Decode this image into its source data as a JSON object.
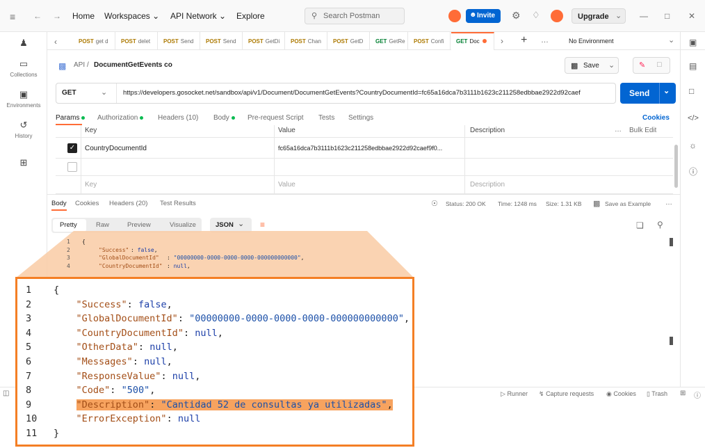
{
  "topbar": {
    "home": "Home",
    "workspaces": "Workspaces",
    "api_network": "API Network",
    "explore": "Explore",
    "search_placeholder": "Search Postman",
    "invite": "Invite",
    "upgrade": "Upgrade"
  },
  "sidebar": {
    "items": [
      {
        "label": "Collections"
      },
      {
        "label": "Environments"
      },
      {
        "label": "History"
      }
    ]
  },
  "tabs": [
    {
      "method": "POST",
      "label": "get d"
    },
    {
      "method": "POST",
      "label": "delet"
    },
    {
      "method": "POST",
      "label": "Send"
    },
    {
      "method": "POST",
      "label": "Send"
    },
    {
      "method": "POST",
      "label": "GetDi"
    },
    {
      "method": "POST",
      "label": "Chan"
    },
    {
      "method": "POST",
      "label": "GetD"
    },
    {
      "method": "GET",
      "label": "GetRe"
    },
    {
      "method": "POST",
      "label": "Confi"
    },
    {
      "method": "GET",
      "label": "Doc"
    }
  ],
  "environment": "No Environment",
  "breadcrumb": {
    "root": "API",
    "sep": "/",
    "name": "DocumentGetEvents co"
  },
  "save_label": "Save",
  "request": {
    "method": "GET",
    "url": "https://developers.gosocket.net/sandbox/api/v1/Document/DocumentGetEvents?CountryDocumentId=fc65a16dca7b3111b1623c211258edbbae2922d92caef",
    "send": "Send"
  },
  "request_tabs": {
    "params": "Params",
    "authorization": "Authorization",
    "headers": "Headers (10)",
    "body": "Body",
    "prerequest": "Pre-request Script",
    "tests": "Tests",
    "settings": "Settings",
    "cookies": "Cookies"
  },
  "params_table": {
    "headers": {
      "key": "Key",
      "value": "Value",
      "description": "Description",
      "bulk": "Bulk Edit"
    },
    "rows": [
      {
        "key": "CountryDocumentId",
        "value": "fc65a16dca7b3111b1623c211258edbbae2922d92caef9f0...",
        "description": ""
      }
    ],
    "placeholder": {
      "key": "Key",
      "value": "Value",
      "description": "Description"
    }
  },
  "response_tabs": {
    "body": "Body",
    "cookies": "Cookies",
    "headers": "Headers (20)",
    "test_results": "Test Results"
  },
  "response_status": {
    "status": "Status: 200 OK",
    "time": "Time: 1248 ms",
    "size": "Size: 1.31 KB",
    "save_example": "Save as Example"
  },
  "view_tabs": {
    "pretty": "Pretty",
    "raw": "Raw",
    "preview": "Preview",
    "visualize": "Visualize",
    "format": "JSON"
  },
  "statusbar": {
    "runner": "Runner",
    "capture": "Capture requests",
    "cookies": "Cookies",
    "trash": "Trash"
  },
  "code_lines": [
    {
      "n": "1",
      "parts": [
        {
          "t": "{",
          "c": "pn"
        }
      ]
    },
    {
      "n": "2",
      "parts": [
        {
          "t": "    ",
          "c": "pn"
        },
        {
          "t": "\"Success\"",
          "c": "key"
        },
        {
          "t": ": ",
          "c": "pn"
        },
        {
          "t": "false",
          "c": "kw"
        },
        {
          "t": ",",
          "c": "pn"
        }
      ]
    },
    {
      "n": "3",
      "parts": [
        {
          "t": "    ",
          "c": "pn"
        },
        {
          "t": "\"GlobalDocumentId\"",
          "c": "key"
        },
        {
          "t": ": ",
          "c": "pn"
        },
        {
          "t": "\"00000000-0000-0000-0000-000000000000\"",
          "c": "str"
        },
        {
          "t": ",",
          "c": "pn"
        }
      ]
    },
    {
      "n": "4",
      "parts": [
        {
          "t": "    ",
          "c": "pn"
        },
        {
          "t": "\"CountryDocumentId\"",
          "c": "key"
        },
        {
          "t": ": ",
          "c": "pn"
        },
        {
          "t": "null",
          "c": "kw"
        },
        {
          "t": ",",
          "c": "pn"
        }
      ]
    },
    {
      "n": "5",
      "parts": [
        {
          "t": "    ",
          "c": "pn"
        },
        {
          "t": "\"OtherData\"",
          "c": "key"
        },
        {
          "t": ": ",
          "c": "pn"
        },
        {
          "t": "null",
          "c": "kw"
        },
        {
          "t": ",",
          "c": "pn"
        }
      ]
    },
    {
      "n": "6",
      "parts": [
        {
          "t": "    ",
          "c": "pn"
        },
        {
          "t": "\"Messages\"",
          "c": "key"
        },
        {
          "t": ": ",
          "c": "pn"
        },
        {
          "t": "null",
          "c": "kw"
        },
        {
          "t": ",",
          "c": "pn"
        }
      ]
    },
    {
      "n": "7",
      "parts": [
        {
          "t": "    ",
          "c": "pn"
        },
        {
          "t": "\"ResponseValue\"",
          "c": "key"
        },
        {
          "t": ": ",
          "c": "pn"
        },
        {
          "t": "null",
          "c": "kw"
        },
        {
          "t": ",",
          "c": "pn"
        }
      ]
    },
    {
      "n": "8",
      "parts": [
        {
          "t": "    ",
          "c": "pn"
        },
        {
          "t": "\"Code\"",
          "c": "key"
        },
        {
          "t": ": ",
          "c": "pn"
        },
        {
          "t": "\"500\"",
          "c": "str"
        },
        {
          "t": ",",
          "c": "pn"
        }
      ]
    },
    {
      "n": "9",
      "highlight": true,
      "parts": [
        {
          "t": "    ",
          "c": "pn"
        },
        {
          "t": "\"Description\"",
          "c": "key"
        },
        {
          "t": ": ",
          "c": "pn"
        },
        {
          "t": "\"Cantidad 52 de consultas ya utilizadas\"",
          "c": "str"
        },
        {
          "t": ",",
          "c": "pn"
        }
      ]
    },
    {
      "n": "10",
      "parts": [
        {
          "t": "    ",
          "c": "pn"
        },
        {
          "t": "\"ErrorException\"",
          "c": "key"
        },
        {
          "t": ": ",
          "c": "pn"
        },
        {
          "t": "null",
          "c": "kw"
        }
      ]
    },
    {
      "n": "11",
      "parts": [
        {
          "t": "}",
          "c": "pn"
        }
      ]
    }
  ],
  "colors": {
    "accent": "#ff6c37",
    "primary": "#0265d2",
    "callout": "#f47f25"
  }
}
